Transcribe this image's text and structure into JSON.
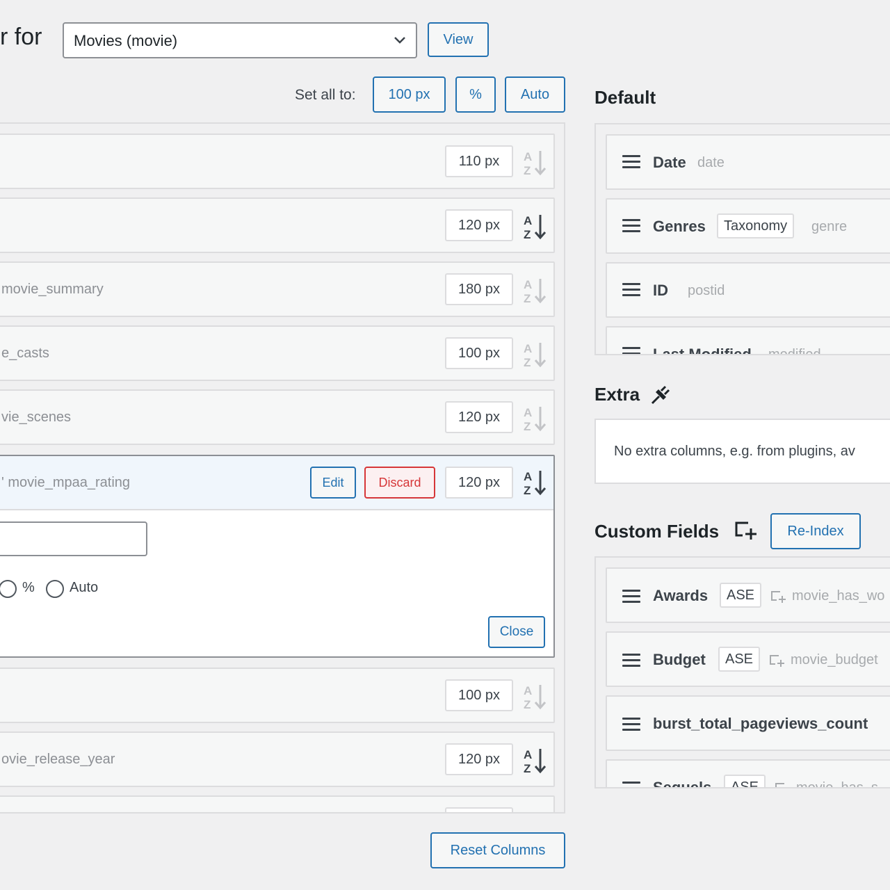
{
  "header": {
    "title_fragment": "r for",
    "post_type_select": "Movies (movie)",
    "view_button": "View"
  },
  "set_all": {
    "label": "Set all to:",
    "options": [
      "100 px",
      "%",
      "Auto"
    ]
  },
  "columns": [
    {
      "slug": "",
      "width": "110 px",
      "sort_active": false
    },
    {
      "slug": "",
      "width": "120 px",
      "sort_active": true
    },
    {
      "slug": "movie_summary",
      "width": "180 px",
      "sort_active": false
    },
    {
      "slug": "e_casts",
      "width": "100 px",
      "sort_active": false
    },
    {
      "slug": "vie_scenes",
      "width": "120 px",
      "sort_active": false
    },
    {
      "slug": "' movie_mpaa_rating",
      "width": "120 px",
      "sort_active": true,
      "edit": "Edit",
      "discard": "Discard"
    },
    {
      "slug": "",
      "width": "100 px",
      "sort_active": false
    },
    {
      "slug": "ovie_release_year",
      "width": "120 px",
      "sort_active": true
    }
  ],
  "expanded": {
    "unit_percent": "%",
    "unit_auto": "Auto",
    "close_button": "Close"
  },
  "reset_button": "Reset Columns",
  "default_section": {
    "title": "Default",
    "items": [
      {
        "name": "Date",
        "badge": "",
        "meta": "date"
      },
      {
        "name": "Genres",
        "badge": "Taxonomy",
        "meta": "genre"
      },
      {
        "name": "ID",
        "badge": "",
        "meta": "postid"
      },
      {
        "name": "Last Modified",
        "badge": "",
        "meta": "modified"
      }
    ]
  },
  "extra_section": {
    "title": "Extra",
    "icon": "plugin-icon",
    "message": "No extra columns, e.g. from plugins, av"
  },
  "custom_fields_section": {
    "title": "Custom Fields",
    "icon": "add-field-icon",
    "reindex_button": "Re-Index",
    "items": [
      {
        "name": "Awards",
        "badge": "ASE",
        "meta": "movie_has_wo"
      },
      {
        "name": "Budget",
        "badge": "ASE",
        "meta": "movie_budget"
      },
      {
        "name": "burst_total_pageviews_count",
        "badge": "",
        "meta": ""
      },
      {
        "name": "Sequels",
        "badge": "ASE",
        "meta": "movie_has_s"
      }
    ]
  },
  "colors": {
    "accent": "#2271b1",
    "danger": "#d63638",
    "border": "#dcdcde",
    "background": "#f0f0f1"
  }
}
